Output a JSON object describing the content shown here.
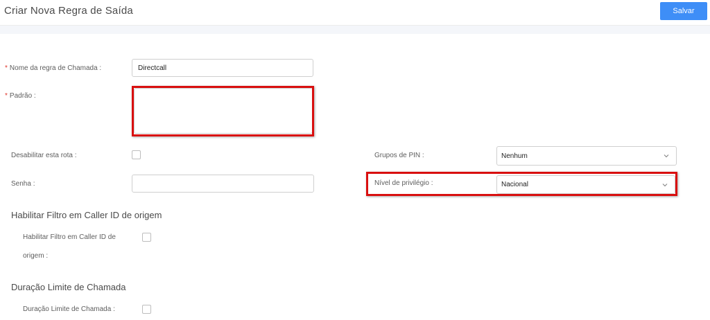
{
  "header": {
    "title": "Criar Nova Regra de Saída",
    "save_label": "Salvar"
  },
  "form": {
    "rule_name": {
      "required_mark": "*",
      "label": "Nome da regra de Chamada :",
      "value": "Directcall"
    },
    "pattern": {
      "required_mark": "*",
      "label": "Padrão :",
      "value": ""
    },
    "disable_route": {
      "label": "Desabilitar esta rota :",
      "checked": false
    },
    "pin_groups": {
      "label": "Grupos de PIN :",
      "value": "Nenhum"
    },
    "password": {
      "label": "Senha :",
      "value": ""
    },
    "privilege_level": {
      "label": "Nível de privilégio :",
      "value": "Nacional"
    }
  },
  "sections": {
    "caller_id_filter": {
      "title": "Habilitar Filtro em Caller ID de origem",
      "label_line1": "Habilitar Filtro em Caller ID de",
      "label_line2": "origem :",
      "checked": false
    },
    "call_duration_limit": {
      "title": "Duração Limite de Chamada",
      "label": "Duração Limite de Chamada :",
      "checked": false
    }
  },
  "annotations": {
    "highlight_color": "#d90f0f"
  },
  "colors": {
    "accent": "#3e8ef7",
    "required": "#e0362c"
  },
  "icons": {
    "select_chevron": "chevron-down-icon"
  }
}
